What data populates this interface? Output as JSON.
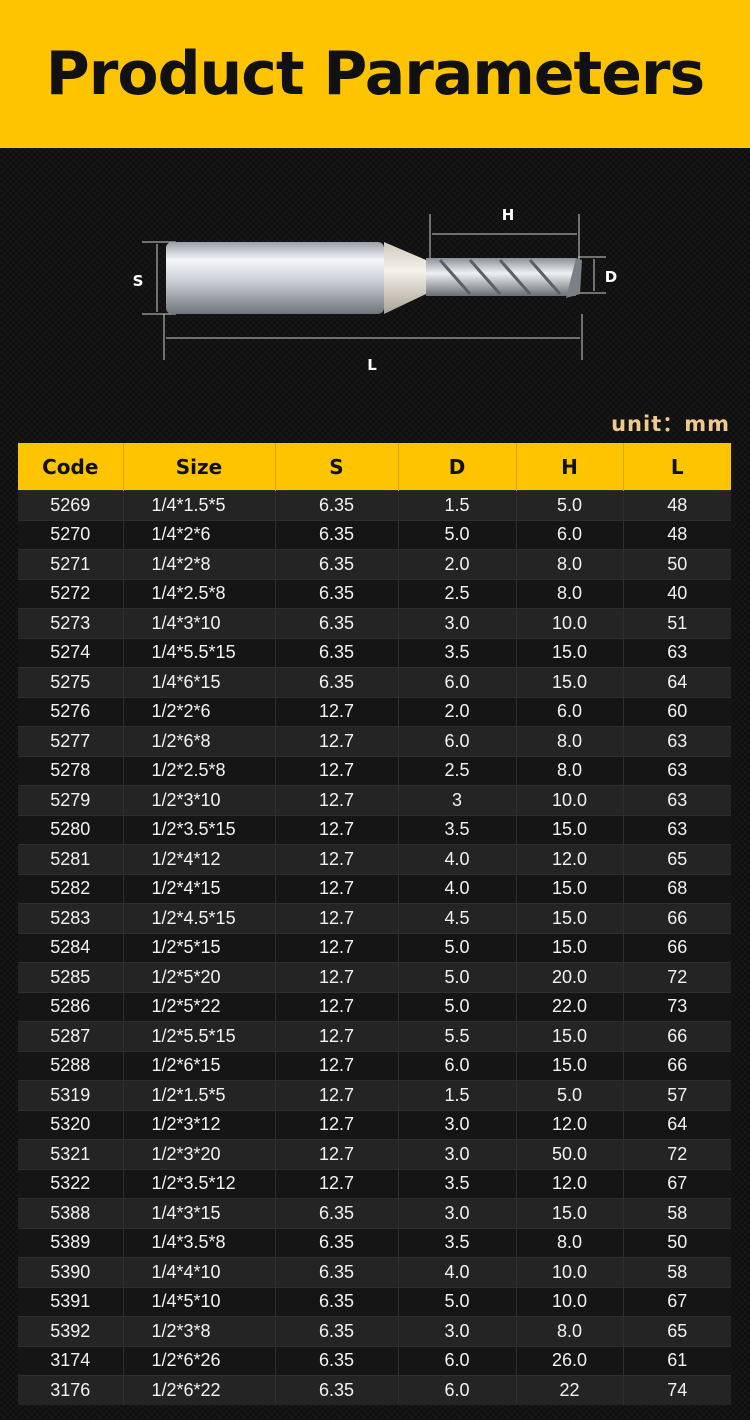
{
  "header": {
    "title": "Product Parameters"
  },
  "diagram": {
    "label_h": "H",
    "label_s": "S",
    "label_d": "D",
    "label_l": "L"
  },
  "unit_label": "unit：mm",
  "colors": {
    "accent": "#ffc400",
    "background": "#101010",
    "unit_text": "#f0ca8c"
  },
  "table": {
    "columns": [
      "Code",
      "Size",
      "S",
      "D",
      "H",
      "L"
    ],
    "rows": [
      [
        "5269",
        "1/4*1.5*5",
        "6.35",
        "1.5",
        "5.0",
        "48"
      ],
      [
        "5270",
        "1/4*2*6",
        "6.35",
        "5.0",
        "6.0",
        "48"
      ],
      [
        "5271",
        "1/4*2*8",
        "6.35",
        "2.0",
        "8.0",
        "50"
      ],
      [
        "5272",
        "1/4*2.5*8",
        "6.35",
        "2.5",
        "8.0",
        "40"
      ],
      [
        "5273",
        "1/4*3*10",
        "6.35",
        "3.0",
        "10.0",
        "51"
      ],
      [
        "5274",
        "1/4*5.5*15",
        "6.35",
        "3.5",
        "15.0",
        "63"
      ],
      [
        "5275",
        "1/4*6*15",
        "6.35",
        "6.0",
        "15.0",
        "64"
      ],
      [
        "5276",
        "1/2*2*6",
        "12.7",
        "2.0",
        "6.0",
        "60"
      ],
      [
        "5277",
        "1/2*6*8",
        "12.7",
        "6.0",
        "8.0",
        "63"
      ],
      [
        "5278",
        "1/2*2.5*8",
        "12.7",
        "2.5",
        "8.0",
        "63"
      ],
      [
        "5279",
        "1/2*3*10",
        "12.7",
        "3",
        "10.0",
        "63"
      ],
      [
        "5280",
        "1/2*3.5*15",
        "12.7",
        "3.5",
        "15.0",
        "63"
      ],
      [
        "5281",
        "1/2*4*12",
        "12.7",
        "4.0",
        "12.0",
        "65"
      ],
      [
        "5282",
        "1/2*4*15",
        "12.7",
        "4.0",
        "15.0",
        "68"
      ],
      [
        "5283",
        "1/2*4.5*15",
        "12.7",
        "4.5",
        "15.0",
        "66"
      ],
      [
        "5284",
        "1/2*5*15",
        "12.7",
        "5.0",
        "15.0",
        "66"
      ],
      [
        "5285",
        "1/2*5*20",
        "12.7",
        "5.0",
        "20.0",
        "72"
      ],
      [
        "5286",
        "1/2*5*22",
        "12.7",
        "5.0",
        "22.0",
        "73"
      ],
      [
        "5287",
        "1/2*5.5*15",
        "12.7",
        "5.5",
        "15.0",
        "66"
      ],
      [
        "5288",
        "1/2*6*15",
        "12.7",
        "6.0",
        "15.0",
        "66"
      ],
      [
        "5319",
        "1/2*1.5*5",
        "12.7",
        "1.5",
        "5.0",
        "57"
      ],
      [
        "5320",
        "1/2*3*12",
        "12.7",
        "3.0",
        "12.0",
        "64"
      ],
      [
        "5321",
        "1/2*3*20",
        "12.7",
        "3.0",
        "50.0",
        "72"
      ],
      [
        "5322",
        "1/2*3.5*12",
        "12.7",
        "3.5",
        "12.0",
        "67"
      ],
      [
        "5388",
        "1/4*3*15",
        "6.35",
        "3.0",
        "15.0",
        "58"
      ],
      [
        "5389",
        "1/4*3.5*8",
        "6.35",
        "3.5",
        "8.0",
        "50"
      ],
      [
        "5390",
        "1/4*4*10",
        "6.35",
        "4.0",
        "10.0",
        "58"
      ],
      [
        "5391",
        "1/4*5*10",
        "6.35",
        "5.0",
        "10.0",
        "67"
      ],
      [
        "5392",
        "1/2*3*8",
        "6.35",
        "3.0",
        "8.0",
        "65"
      ],
      [
        "3174",
        "1/2*6*26",
        "6.35",
        "6.0",
        "26.0",
        "61"
      ],
      [
        "3176",
        "1/2*6*22",
        "6.35",
        "6.0",
        "22",
        "74"
      ]
    ]
  }
}
